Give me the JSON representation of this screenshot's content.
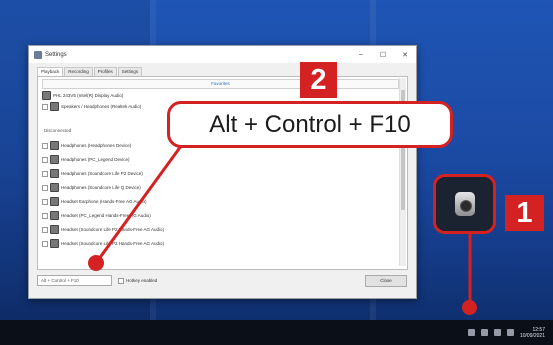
{
  "window": {
    "title": "Settings",
    "tabs": [
      "Playback",
      "Recording",
      "Profiles",
      "Settings"
    ],
    "active_tab": "Playback",
    "favorites_header": "Favorites",
    "connected_devices": [
      "PHL 243V5 (Intel(R) Display Audio)",
      "Speakers / Headphones (Realtek Audio)"
    ],
    "disconnected_label": "Disconnected",
    "disconnected_devices": [
      "Headphones (Headphones Device)",
      "Headphones (PC_Legend Device)",
      "Headphones (Soundcore Life P2 Device)",
      "Headphones (Soundcore Life Q Device)",
      "Headset Earphone (Hands-Free AG Audio)",
      "Headset (PC_Legend Hands-Free AG Audio)",
      "Headset (Soundcore Life P2 Hands-Free AG Audio)",
      "Headset (Soundcore Life P2 Hands-Free AG Audio)"
    ],
    "hotkey_value": "Alt + Control + F10",
    "hotkey_option_label": "Hotkey enabled",
    "close_label": "Close"
  },
  "callout": {
    "text": "Alt + Control + F10"
  },
  "badges": {
    "one": "1",
    "two": "2"
  },
  "taskbar": {
    "time": "12:57",
    "date": "10/09/2021"
  },
  "colors": {
    "accent_red": "#d42121",
    "desktop_blue": "#1b4aa3",
    "taskbar": "#0a0f18"
  },
  "icons": [
    "speaker-tray-icon",
    "close-icon",
    "minimize-icon",
    "maximize-icon"
  ]
}
